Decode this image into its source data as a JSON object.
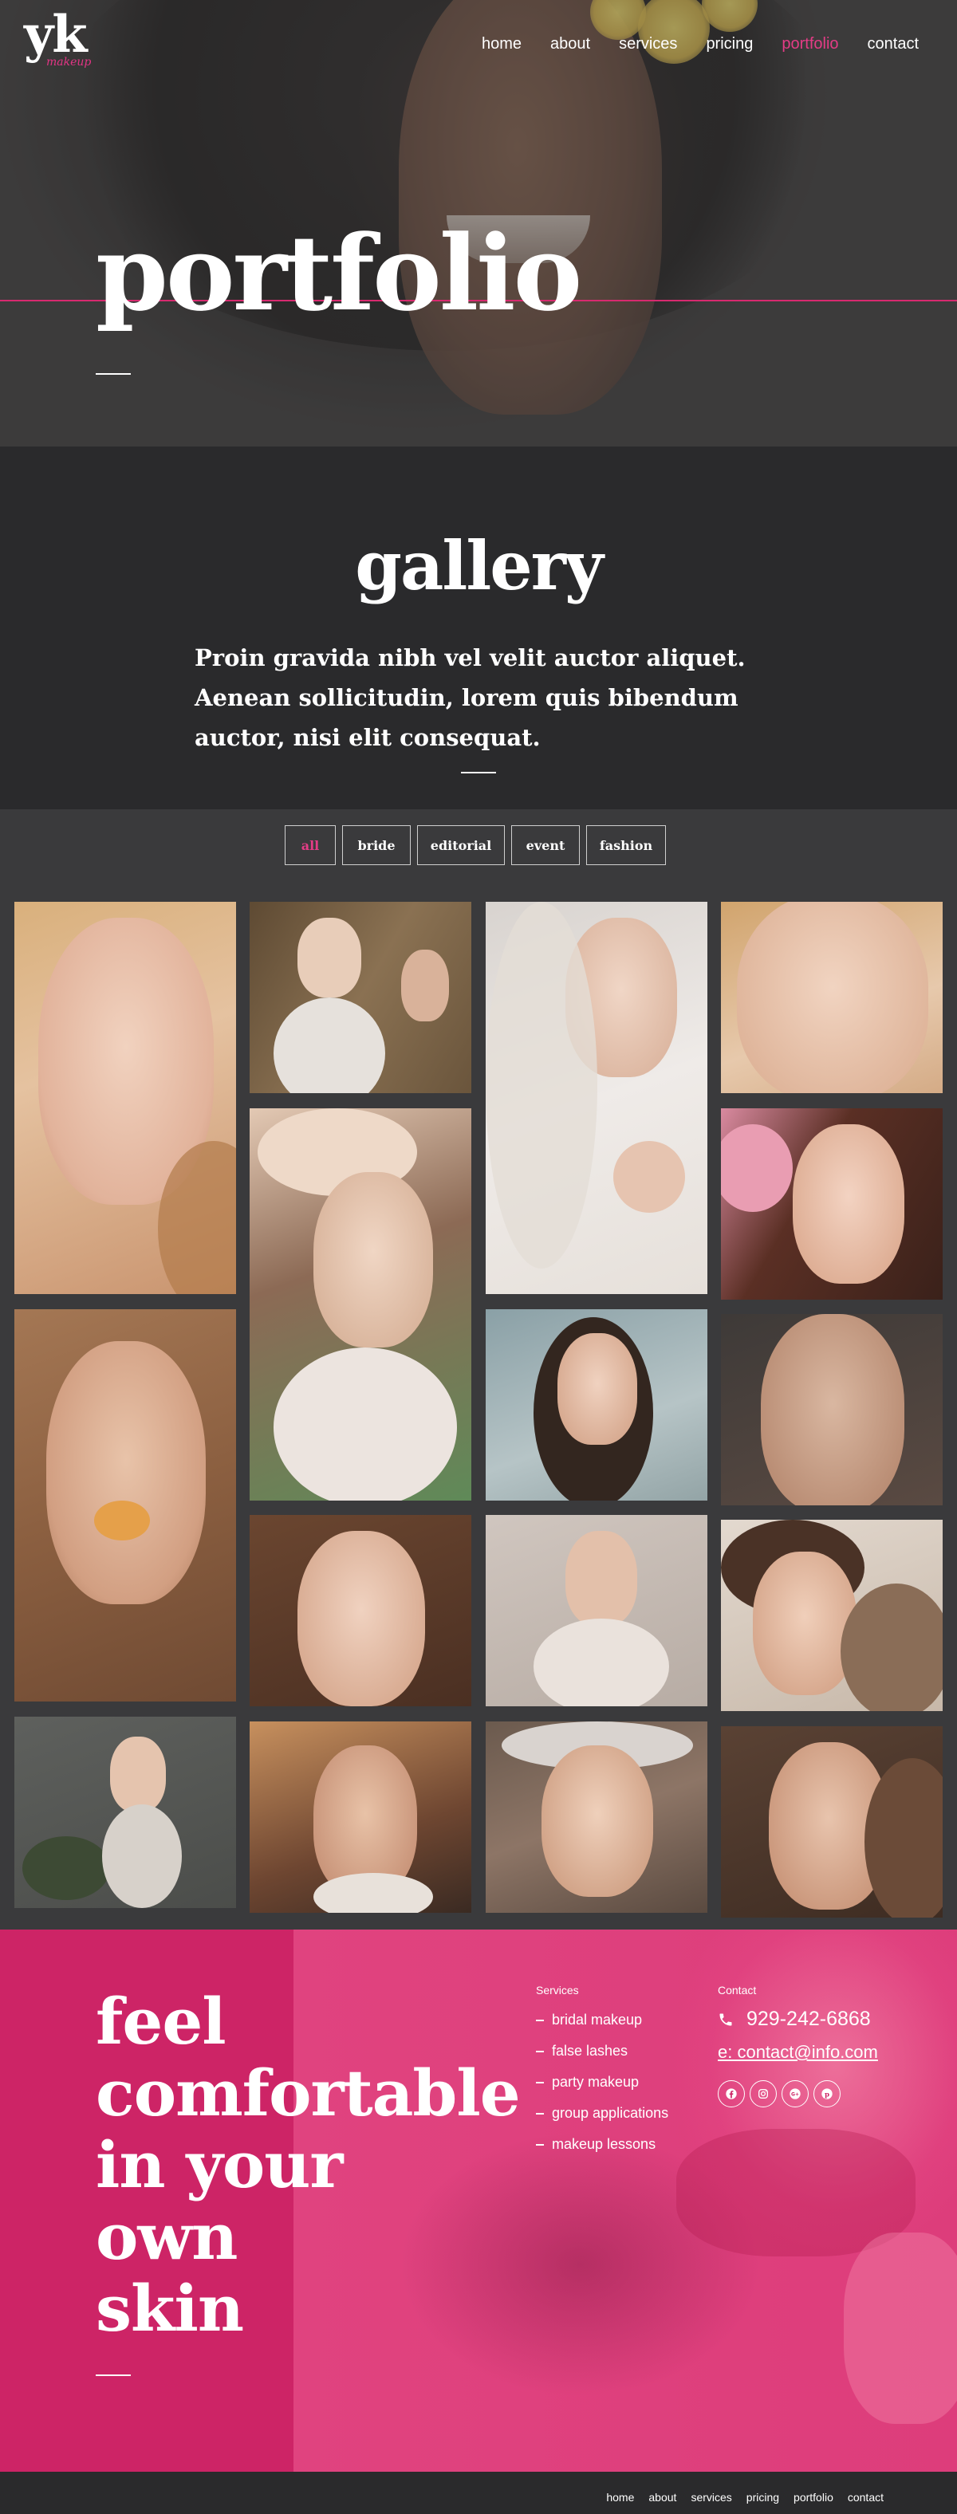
{
  "brand": {
    "logo_text": "yk",
    "logo_signature": "makeup"
  },
  "nav": {
    "items": [
      {
        "label": "home"
      },
      {
        "label": "about"
      },
      {
        "label": "services"
      },
      {
        "label": "pricing"
      },
      {
        "label": "portfolio"
      },
      {
        "label": "contact"
      }
    ],
    "active": "portfolio"
  },
  "hero": {
    "title": "portfolio"
  },
  "gallery": {
    "heading": "gallery",
    "description": "Proin gravida nibh vel velit auctor aliquet. Aenean sollicitudin, lorem quis bibendum auctor, nisi elit consequat."
  },
  "filters": {
    "items": [
      {
        "label": "all"
      },
      {
        "label": "bride"
      },
      {
        "label": "editorial"
      },
      {
        "label": "event"
      },
      {
        "label": "fashion"
      }
    ],
    "active": "all"
  },
  "cta": {
    "line1": "feel",
    "line2": "comfortable",
    "line3": "in your",
    "line4": "own",
    "line5": "skin"
  },
  "services": {
    "heading": "Services",
    "items": [
      {
        "label": "bridal makeup"
      },
      {
        "label": "false lashes"
      },
      {
        "label": "party makeup"
      },
      {
        "label": "group applications"
      },
      {
        "label": "makeup lessons"
      }
    ]
  },
  "contact": {
    "heading": "Contact",
    "phone": "929-242-6868",
    "email": "e: contact@info.com",
    "social_icons": [
      "facebook-icon",
      "instagram-icon",
      "google-plus-icon",
      "pinterest-icon"
    ]
  },
  "footer": {
    "items": [
      {
        "label": "home"
      },
      {
        "label": "about"
      },
      {
        "label": "services"
      },
      {
        "label": "pricing"
      },
      {
        "label": "portfolio"
      },
      {
        "label": "contact"
      }
    ]
  },
  "colors": {
    "accent": "#e43c86",
    "cta_bg": "#cd2466",
    "dark_bg": "#2a2a2c",
    "grid_bg": "#3a3a3c"
  }
}
